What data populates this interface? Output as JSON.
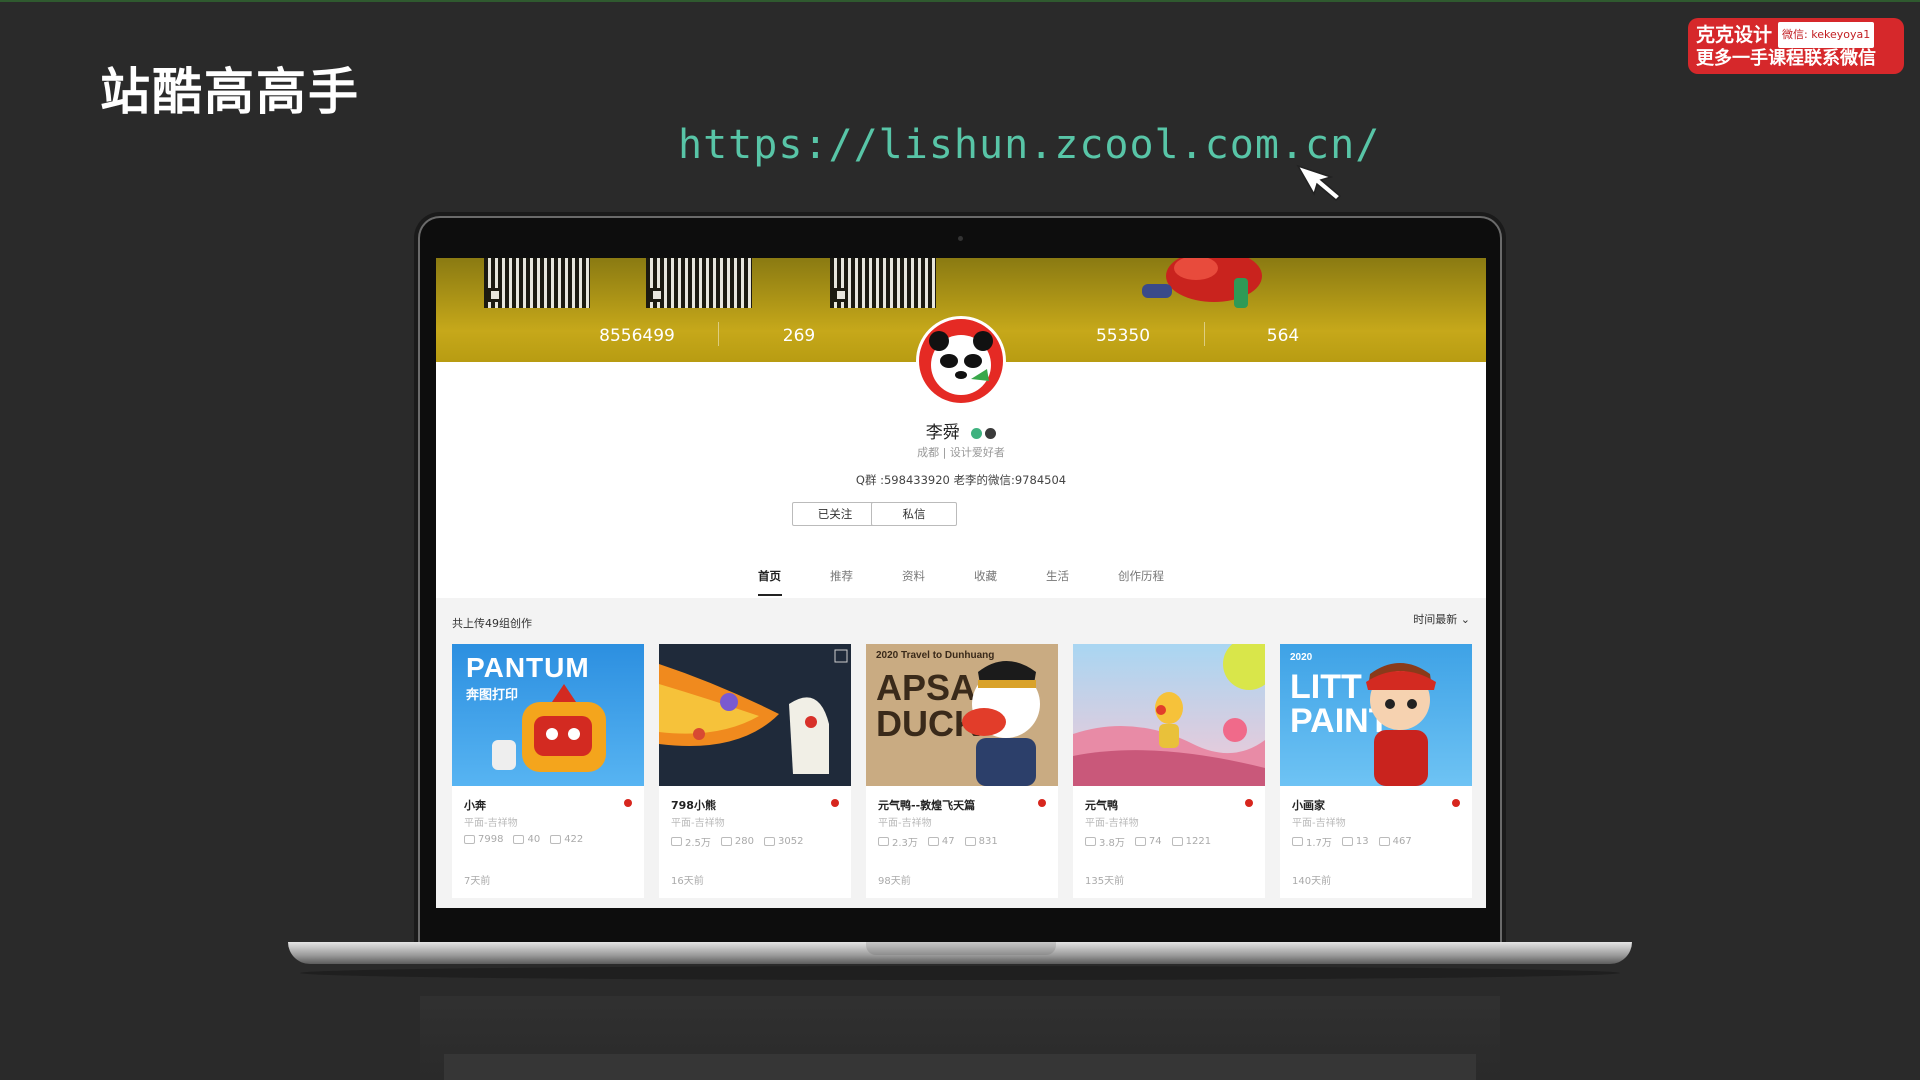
{
  "slide": {
    "title": "站酷高高手",
    "url": "https://lishun.zcool.com.cn/"
  },
  "watermark": {
    "brand": "克克设计",
    "wechat": "微信: kekeyoya1",
    "line2": "更多一手课程联系微信"
  },
  "profile": {
    "stats": [
      "8556499",
      "269",
      "55350",
      "564"
    ],
    "name": "李舜",
    "meta": "成都 | 设计爱好者",
    "contact": "Q群 :598433920 老李的微信:9784504",
    "follow_label": "已关注",
    "message_label": "私信"
  },
  "tabs": [
    "首页",
    "推荐",
    "资料",
    "收藏",
    "生活",
    "创作历程"
  ],
  "active_tab": "首页",
  "works": {
    "total_label": "共上传49组创作",
    "sort_label": "时间最新",
    "cards": [
      {
        "title": "小奔",
        "category": "平面-吉祥物",
        "views": "7998",
        "comments": "40",
        "likes": "422",
        "time": "7天前",
        "art_text": "PANTUM",
        "art_sub": "奔图打印"
      },
      {
        "title": "798小熊",
        "category": "平面-吉祥物",
        "views": "2.5万",
        "comments": "280",
        "likes": "3052",
        "time": "16天前"
      },
      {
        "title": "元气鸭--敦煌飞天篇",
        "category": "平面-吉祥物",
        "views": "2.3万",
        "comments": "47",
        "likes": "831",
        "time": "98天前",
        "art_text": "APSA DUCK",
        "art_sub": "2020 Travel to Dunhuang"
      },
      {
        "title": "元气鸭",
        "category": "平面-吉祥物",
        "views": "3.8万",
        "comments": "74",
        "likes": "1221",
        "time": "135天前"
      },
      {
        "title": "小画家",
        "category": "平面-吉祥物",
        "views": "1.7万",
        "comments": "13",
        "likes": "467",
        "time": "140天前",
        "art_text": "LITT PAINT",
        "art_sub": "2020"
      }
    ]
  },
  "colors": {
    "url": "#58c5a7",
    "banner": "#c6a81a",
    "accent_red": "#d7261e"
  }
}
